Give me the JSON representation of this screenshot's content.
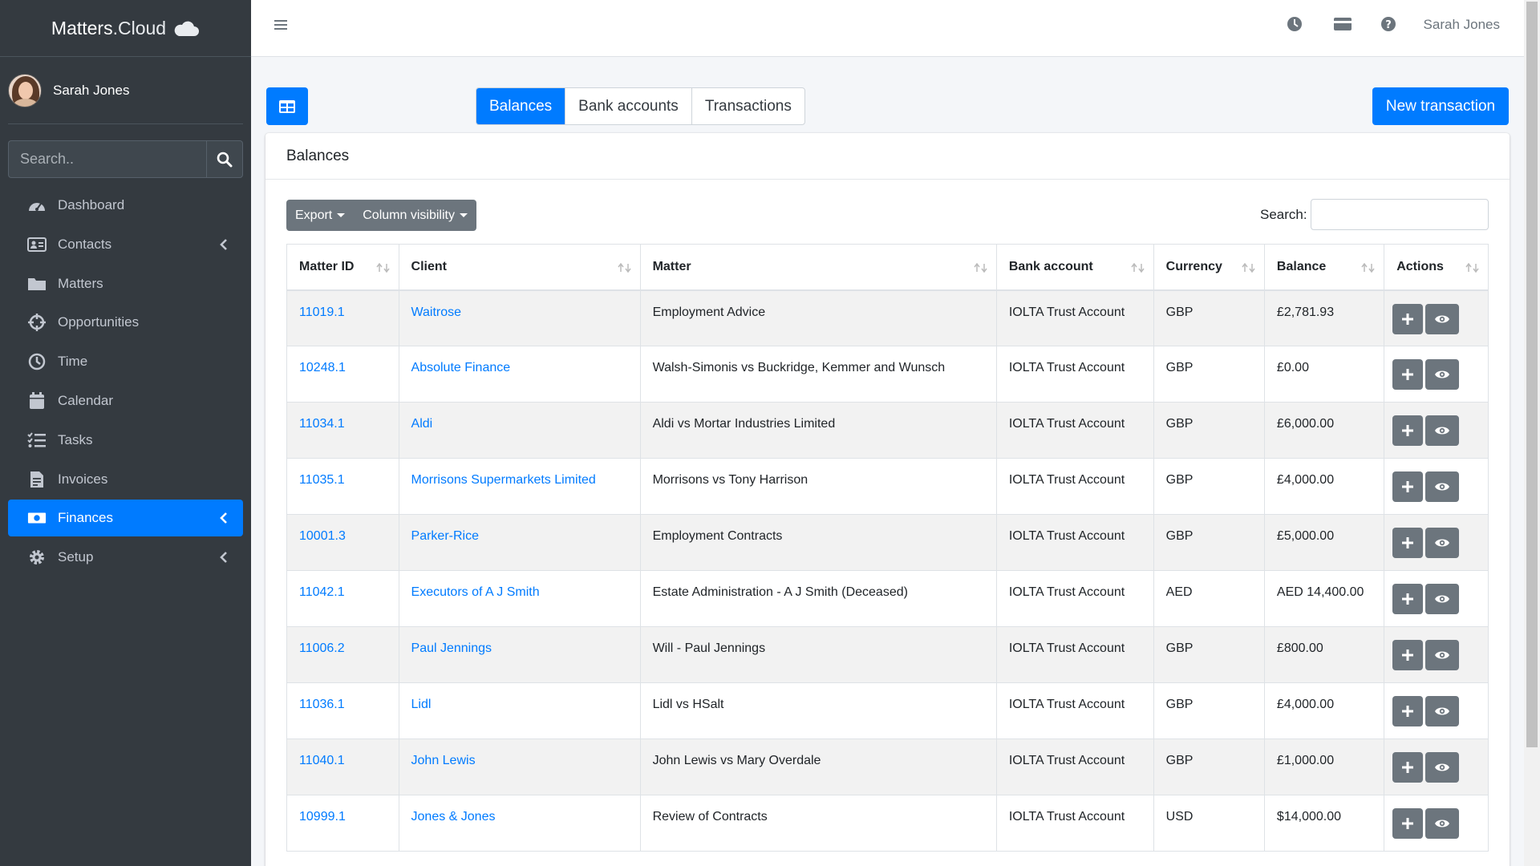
{
  "brand": {
    "name_bold": "Matters",
    "name_light": ".Cloud"
  },
  "user": {
    "name": "Sarah Jones"
  },
  "sidebar": {
    "search_placeholder": "Search..",
    "items": [
      {
        "label": "Dashboard",
        "icon": "dashboard-icon",
        "has_chevron": false
      },
      {
        "label": "Contacts",
        "icon": "address-card-icon",
        "has_chevron": true
      },
      {
        "label": "Matters",
        "icon": "folder-icon",
        "has_chevron": false
      },
      {
        "label": "Opportunities",
        "icon": "crosshairs-icon",
        "has_chevron": false
      },
      {
        "label": "Time",
        "icon": "clock-icon",
        "has_chevron": false
      },
      {
        "label": "Calendar",
        "icon": "calendar-icon",
        "has_chevron": false
      },
      {
        "label": "Tasks",
        "icon": "tasks-list-icon",
        "has_chevron": false
      },
      {
        "label": "Invoices",
        "icon": "invoice-file-icon",
        "has_chevron": false
      },
      {
        "label": "Finances",
        "icon": "money-bill-icon",
        "has_chevron": true,
        "active": true
      },
      {
        "label": "Setup",
        "icon": "gear-icon",
        "has_chevron": true
      }
    ]
  },
  "topbar": {
    "user_name": "Sarah Jones",
    "icons": [
      "clock-icon",
      "credit-card-icon",
      "help-icon"
    ]
  },
  "tabs": [
    "Balances",
    "Bank accounts",
    "Transactions"
  ],
  "active_tab": "Balances",
  "new_transaction_label": "New transaction",
  "card": {
    "title": "Balances",
    "export_label": "Export",
    "column_visibility_label": "Column visibility",
    "search_label": "Search:"
  },
  "table": {
    "headers": [
      "Matter ID",
      "Client",
      "Matter",
      "Bank account",
      "Currency",
      "Balance",
      "Actions"
    ],
    "rows": [
      [
        "11019.1",
        "Waitrose",
        "Employment Advice",
        "IOLTA Trust Account",
        "GBP",
        "£2,781.93"
      ],
      [
        "10248.1",
        "Absolute Finance",
        "Walsh-Simonis vs Buckridge, Kemmer and Wunsch",
        "IOLTA Trust Account",
        "GBP",
        "£0.00"
      ],
      [
        "11034.1",
        "Aldi",
        "Aldi vs Mortar Industries Limited",
        "IOLTA Trust Account",
        "GBP",
        "£6,000.00"
      ],
      [
        "11035.1",
        "Morrisons Supermarkets Limited",
        "Morrisons vs Tony Harrison",
        "IOLTA Trust Account",
        "GBP",
        "£4,000.00"
      ],
      [
        "10001.3",
        "Parker-Rice",
        "Employment Contracts",
        "IOLTA Trust Account",
        "GBP",
        "£5,000.00"
      ],
      [
        "11042.1",
        "Executors of A J Smith",
        "Estate Administration - A J Smith (Deceased)",
        "IOLTA Trust Account",
        "AED",
        "AED 14,400.00"
      ],
      [
        "11006.2",
        "Paul Jennings",
        "Will - Paul Jennings",
        "IOLTA Trust Account",
        "GBP",
        "£800.00"
      ],
      [
        "11036.1",
        "Lidl",
        "Lidl vs HSalt",
        "IOLTA Trust Account",
        "GBP",
        "£4,000.00"
      ],
      [
        "11040.1",
        "John Lewis",
        "John Lewis vs Mary Overdale",
        "IOLTA Trust Account",
        "GBP",
        "£1,000.00"
      ],
      [
        "10999.1",
        "Jones & Jones",
        "Review of Contracts",
        "IOLTA Trust Account",
        "USD",
        "$14,000.00"
      ]
    ]
  },
  "colors": {
    "primary": "#007bff",
    "sidebar_bg": "#343a40",
    "secondary": "#6c757d"
  }
}
